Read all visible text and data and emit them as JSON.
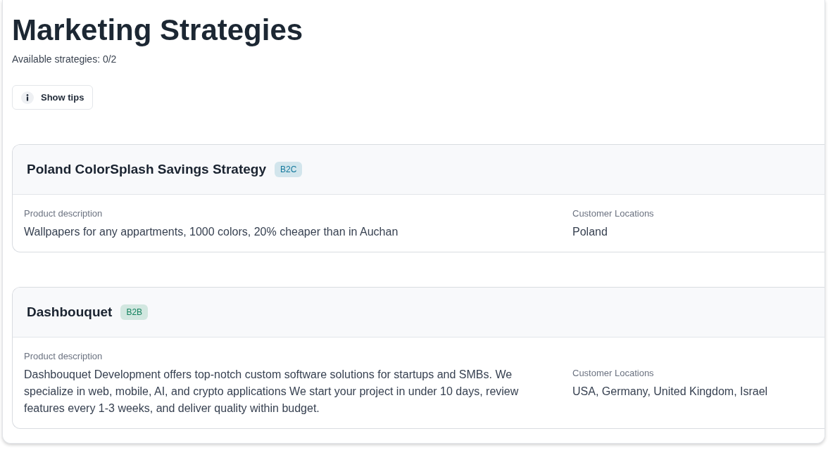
{
  "header": {
    "title": "Marketing Strategies",
    "subtitle": "Available strategies: 0/2"
  },
  "tips_button": {
    "label": "Show tips"
  },
  "strategies": [
    {
      "name": "Poland ColorSplash Savings Strategy",
      "badge": {
        "label": "B2C",
        "color": "#12789c"
      },
      "fields": [
        {
          "label": "Product description",
          "value": "Wallpapers for any appartments, 1000 colors, 20% cheaper than in Auchan"
        },
        {
          "label": "Customer Locations",
          "value": "Poland"
        }
      ]
    },
    {
      "name": "Dashbouquet",
      "badge": {
        "label": "B2B",
        "color": "#14825e"
      },
      "fields": [
        {
          "label": "Product description",
          "value": "Dashbouquet Development offers top-notch custom software solutions for startups and SMBs. We specialize in web, mobile, AI, and crypto applications We start your project in under 10 days, review features every 1-3 weeks, and deliver quality within budget."
        },
        {
          "label": "Customer Locations",
          "value": "USA, Germany, United Kingdom, Israel"
        }
      ]
    }
  ]
}
